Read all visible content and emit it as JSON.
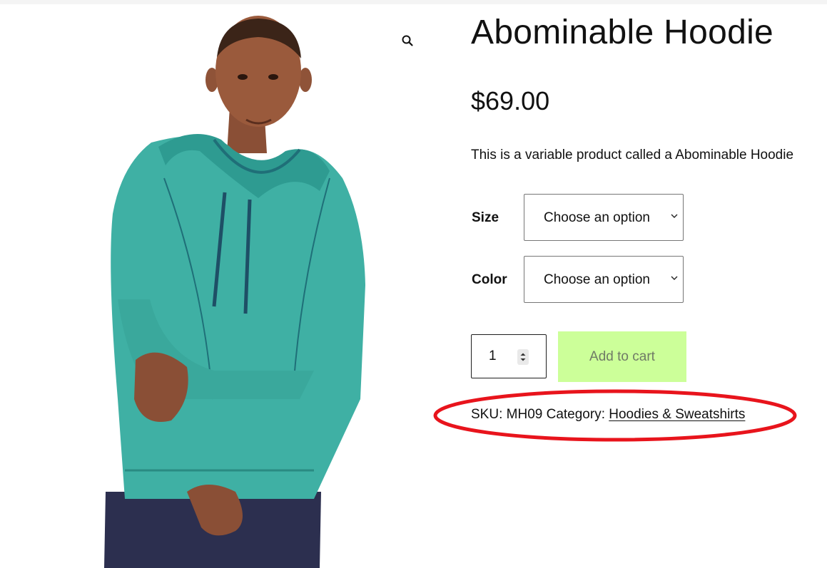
{
  "product": {
    "title": "Abominable Hoodie",
    "price": "$69.00",
    "description": "This is a variable product called a Abominable Hoodie",
    "image_alt": "Model wearing a teal heathered pullover hoodie with navy drawstrings and navy pants"
  },
  "variations": [
    {
      "label": "Size",
      "selected": "Choose an option"
    },
    {
      "label": "Color",
      "selected": "Choose an option"
    }
  ],
  "cart": {
    "quantity": "1",
    "add_to_cart_label": "Add to cart",
    "button_color": "#ccff99"
  },
  "meta": {
    "sku_label": "SKU:",
    "sku": "MH09",
    "category_label": "Category:",
    "category": "Hoodies & Sweatshirts"
  },
  "icons": {
    "zoom": "magnifier-icon"
  },
  "annotation_color": "#e8141c"
}
